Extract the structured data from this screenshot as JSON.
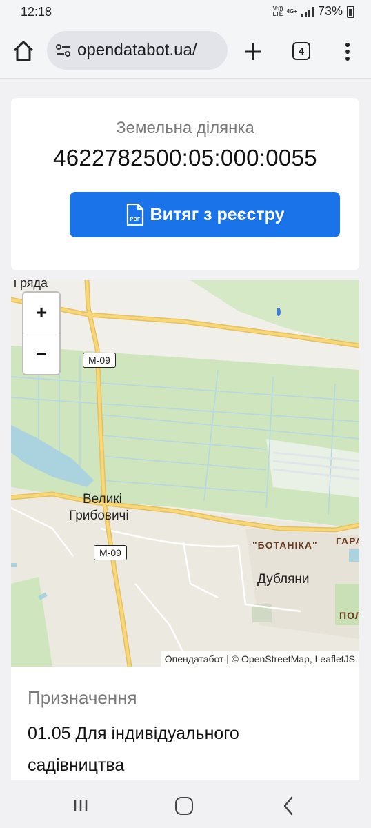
{
  "status_bar": {
    "time": "12:18",
    "volte": "Vo)) LTE",
    "network": "4G+",
    "battery_percent": "73%"
  },
  "browser": {
    "url": "opendatabot.ua/",
    "tab_count": "4"
  },
  "land_card": {
    "subtitle": "Земельна ділянка",
    "cadastral_number": "4622782500:05:000:0055",
    "extract_button_label": "Витяг з реєстру",
    "pdf_icon_text": "PDF"
  },
  "map": {
    "zoom_in_label": "+",
    "zoom_out_label": "−",
    "labels": {
      "top_left_fragment": "і ряда",
      "village_line1": "Великі",
      "village_line2": "Грибовичі",
      "district": "\"БОТАНІКА\"",
      "town": "Дубляни",
      "edge_fragment_1": "ГАРА",
      "edge_fragment_2": "ПОЛ"
    },
    "road_shield_1": "M-09",
    "road_shield_2": "M-09",
    "attribution": "Опендатабот | © OpenStreetMap, LeafletJS"
  },
  "purpose": {
    "title": "Призначення",
    "value": "01.05 Для індивідуального садівництва"
  },
  "colors": {
    "accent_button": "#1a73e8",
    "map_field_green": "#cfe5bd",
    "map_road_yellow": "#f6d77a",
    "map_water": "#aad3df"
  }
}
